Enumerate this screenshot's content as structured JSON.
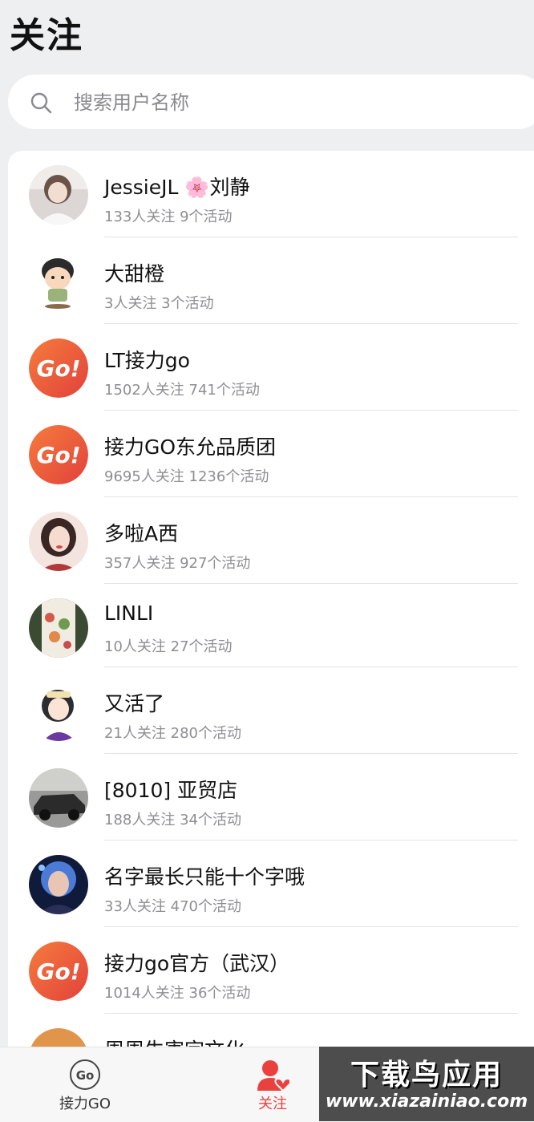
{
  "header": {
    "title": "关注"
  },
  "search": {
    "placeholder": "搜索用户名称",
    "icon": "search-icon"
  },
  "follows": [
    {
      "name": "JessieJL 🌸刘静",
      "meta": "133人关注 9个活动",
      "avatar": "photo-girl"
    },
    {
      "name": "大甜橙",
      "meta": "3人关注 3个活动",
      "avatar": "cartoon-boy"
    },
    {
      "name": "LT接力go",
      "meta": "1502人关注 741个活动",
      "avatar": "go-logo"
    },
    {
      "name": "接力GO东允品质团",
      "meta": "9695人关注 1236个活动",
      "avatar": "go-logo"
    },
    {
      "name": "多啦A西",
      "meta": "357人关注 927个活动",
      "avatar": "illustrated-girl"
    },
    {
      "name": "LINLI",
      "meta": "10人关注 27个活动",
      "avatar": "floral-dress"
    },
    {
      "name": "又活了",
      "meta": "21人关注 280个活动",
      "avatar": "anime-girl"
    },
    {
      "name": "[8010] 亚贸店",
      "meta": "188人关注 34个活动",
      "avatar": "dark-car"
    },
    {
      "name": "名字最长只能十个字哦",
      "meta": "33人关注 470个活动",
      "avatar": "neon-portrait"
    },
    {
      "name": "接力go官方（武汉）",
      "meta": "1014人关注 36个活动",
      "avatar": "go-logo"
    },
    {
      "name": "周周生害字文化",
      "meta": "",
      "avatar": "orange-avatar"
    }
  ],
  "tabbar": {
    "tabs": [
      {
        "label": "接力GO",
        "icon": "go-badge-icon",
        "active": false
      },
      {
        "label": "关注",
        "icon": "person-heart-icon",
        "active": true
      }
    ]
  },
  "watermark": {
    "top": "下载鸟应用",
    "bottom": "www.xiazainiao.com"
  },
  "colors": {
    "accent": "#e9423e",
    "go_gradient_start": "#f57c3c",
    "go_gradient_end": "#e2413c"
  }
}
